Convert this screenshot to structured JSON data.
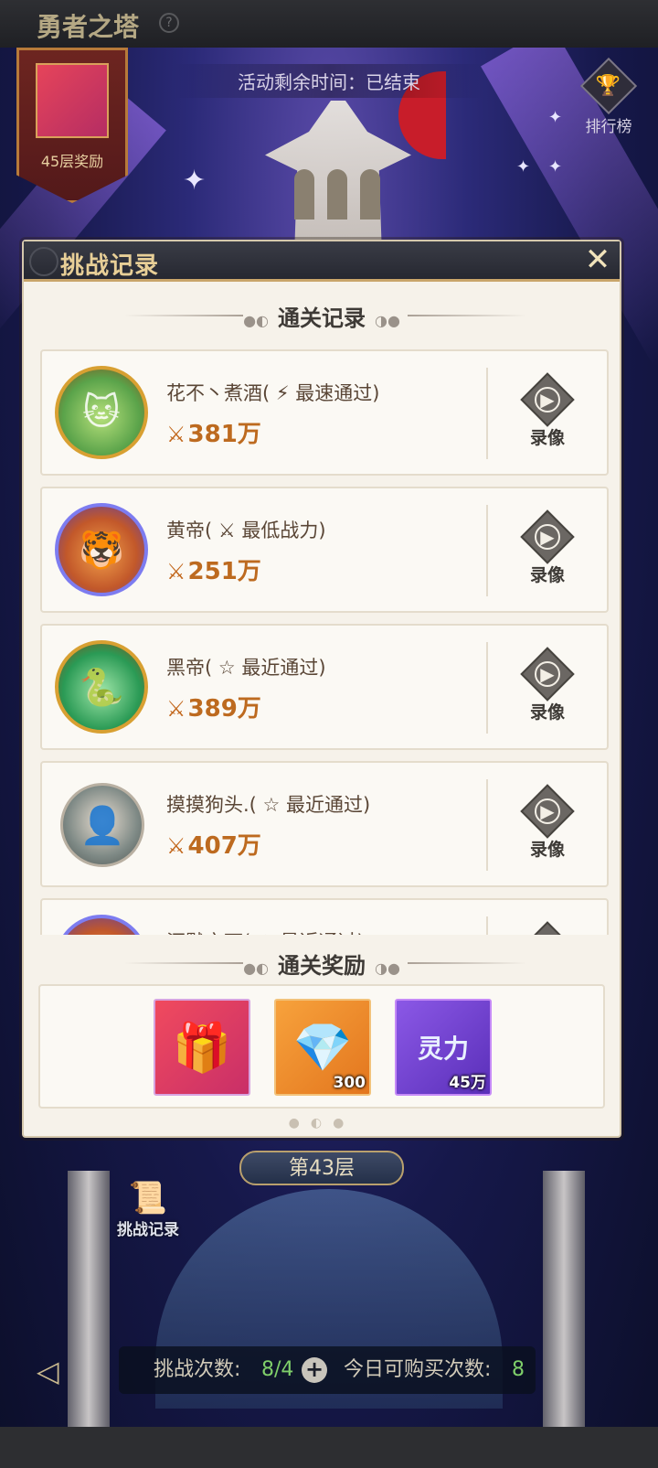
{
  "header": {
    "title": "勇者之塔",
    "help_icon": "?"
  },
  "banner": {
    "reward_label": "45层奖励"
  },
  "event": {
    "timer_text": "活动剩余时间：已结束"
  },
  "ranking": {
    "label": "排行榜"
  },
  "modal": {
    "title": "挑战记录",
    "close_icon": "✕",
    "records_section_title": "通关记录",
    "rewards_section_title": "通关奖励",
    "replay_label": "录像",
    "records": [
      {
        "name": "花不丶煮酒( ⚡ 最速通过)",
        "power": "381万"
      },
      {
        "name": "黄帝( ⚔ 最低战力)",
        "power": "251万"
      },
      {
        "name": "黑帝( ☆ 最近通过)",
        "power": "389万"
      },
      {
        "name": "摸摸狗头.( ☆ 最近通过)",
        "power": "407万"
      },
      {
        "name": "沉默之下( ☆ 最近通过)",
        "power": ""
      }
    ],
    "rewards": [
      {
        "type": "gift-box",
        "count": ""
      },
      {
        "type": "diamond",
        "count": "300"
      },
      {
        "type": "spirit-power",
        "label": "灵力",
        "count": "45万"
      }
    ]
  },
  "floor": {
    "label": "第43层"
  },
  "bottom": {
    "records_button": "挑战记录",
    "challenge_label": "挑战次数:",
    "challenge_value": "8/4",
    "buy_label": "今日可购买次数:",
    "buy_value": "8"
  }
}
